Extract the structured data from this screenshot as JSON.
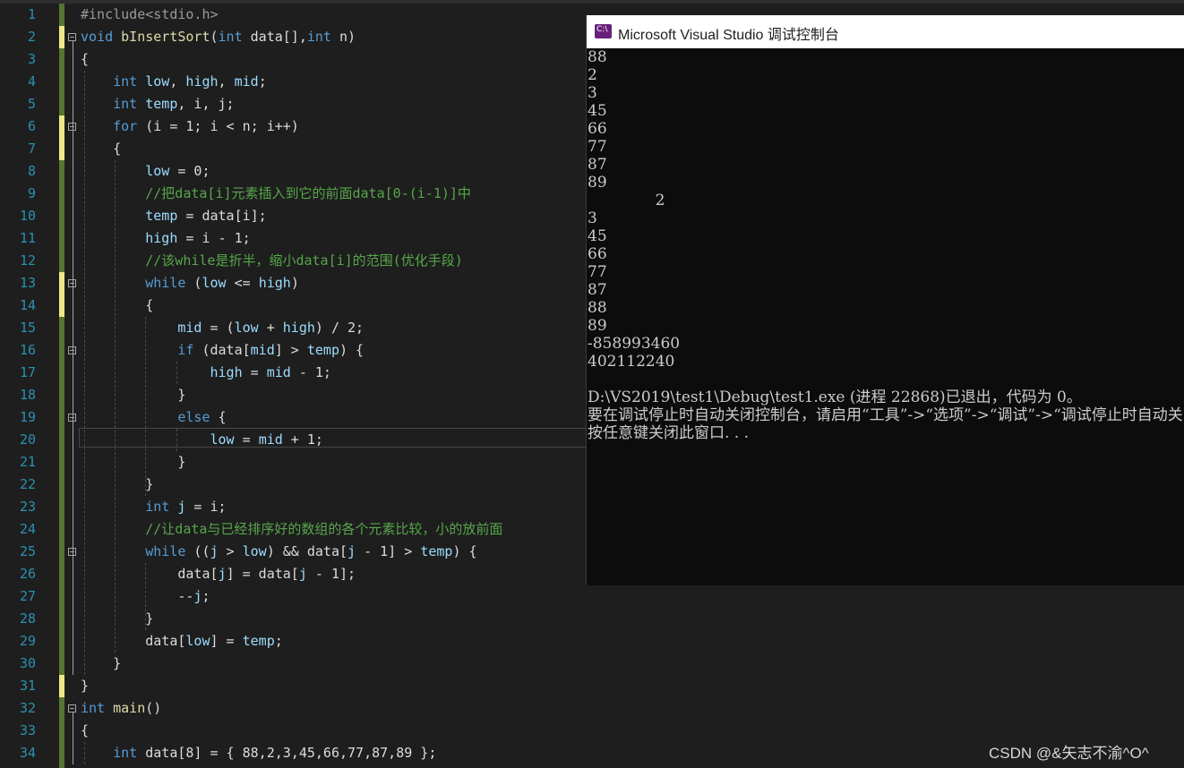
{
  "console": {
    "title": "Microsoft Visual Studio 调试控制台",
    "icon": "vs-icon",
    "output_lines": [
      "88",
      "2",
      "3",
      "45",
      "66",
      "77",
      "87",
      "89",
      "              2",
      "3",
      "45",
      "66",
      "77",
      "87",
      "88",
      "89",
      "-858993460",
      "402112240",
      "",
      "D:\\VS2019\\test1\\Debug\\test1.exe (进程 22868)已退出，代码为 0。",
      "要在调试停止时自动关闭控制台，请启用“工具”->“选项”->“调试”->“调试停止时自动关闭控制台”。",
      "按任意键关闭此窗口. . ."
    ]
  },
  "editor": {
    "line_numbers": [
      "1",
      "2",
      "3",
      "4",
      "5",
      "6",
      "7",
      "8",
      "9",
      "10",
      "11",
      "12",
      "13",
      "14",
      "15",
      "16",
      "17",
      "18",
      "19",
      "20",
      "21",
      "22",
      "23",
      "24",
      "25",
      "26",
      "27",
      "28",
      "29",
      "30",
      "31",
      "32",
      "33",
      "34"
    ],
    "lines": [
      [
        {
          "t": "#include<stdio.h>",
          "c": "pp"
        }
      ],
      [
        {
          "t": "void",
          "c": "kw"
        },
        {
          "t": " "
        },
        {
          "t": "bInsertSort",
          "c": "fn"
        },
        {
          "t": "("
        },
        {
          "t": "int",
          "c": "kw"
        },
        {
          "t": " data[],"
        },
        {
          "t": "int",
          "c": "kw"
        },
        {
          "t": " n)"
        }
      ],
      [
        {
          "t": "{"
        }
      ],
      [
        {
          "t": "    "
        },
        {
          "t": "int",
          "c": "kw"
        },
        {
          "t": " "
        },
        {
          "t": "low",
          "c": "var"
        },
        {
          "t": ", "
        },
        {
          "t": "high",
          "c": "var"
        },
        {
          "t": ", "
        },
        {
          "t": "mid",
          "c": "var"
        },
        {
          "t": ";"
        }
      ],
      [
        {
          "t": "    "
        },
        {
          "t": "int",
          "c": "kw"
        },
        {
          "t": " "
        },
        {
          "t": "temp",
          "c": "var"
        },
        {
          "t": ", i, j;"
        }
      ],
      [
        {
          "t": "    "
        },
        {
          "t": "for",
          "c": "kw"
        },
        {
          "t": " (i = 1; i < n; i++)"
        }
      ],
      [
        {
          "t": "    {"
        }
      ],
      [
        {
          "t": "        "
        },
        {
          "t": "low",
          "c": "var"
        },
        {
          "t": " = 0;"
        }
      ],
      [
        {
          "t": "        "
        },
        {
          "t": "//把data[i]元素插入到它的前面data[0-(i-1)]中",
          "c": "cm"
        }
      ],
      [
        {
          "t": "        "
        },
        {
          "t": "temp",
          "c": "var"
        },
        {
          "t": " = data[i];"
        }
      ],
      [
        {
          "t": "        "
        },
        {
          "t": "high",
          "c": "var"
        },
        {
          "t": " = i - 1;"
        }
      ],
      [
        {
          "t": "        "
        },
        {
          "t": "//该while是折半，缩小data[i]的范围(优化手段)",
          "c": "cm"
        }
      ],
      [
        {
          "t": "        "
        },
        {
          "t": "while",
          "c": "kw"
        },
        {
          "t": " ("
        },
        {
          "t": "low",
          "c": "var"
        },
        {
          "t": " <= "
        },
        {
          "t": "high",
          "c": "var"
        },
        {
          "t": ")"
        }
      ],
      [
        {
          "t": "        {"
        }
      ],
      [
        {
          "t": "            "
        },
        {
          "t": "mid",
          "c": "var"
        },
        {
          "t": " = ("
        },
        {
          "t": "low",
          "c": "var"
        },
        {
          "t": " + "
        },
        {
          "t": "high",
          "c": "var"
        },
        {
          "t": ") / 2;"
        }
      ],
      [
        {
          "t": "            "
        },
        {
          "t": "if",
          "c": "kw"
        },
        {
          "t": " (data["
        },
        {
          "t": "mid",
          "c": "var"
        },
        {
          "t": "] > "
        },
        {
          "t": "temp",
          "c": "var"
        },
        {
          "t": ") {"
        }
      ],
      [
        {
          "t": "                "
        },
        {
          "t": "high",
          "c": "var"
        },
        {
          "t": " = "
        },
        {
          "t": "mid",
          "c": "var"
        },
        {
          "t": " - 1;"
        }
      ],
      [
        {
          "t": "            }"
        }
      ],
      [
        {
          "t": "            "
        },
        {
          "t": "else",
          "c": "kw"
        },
        {
          "t": " {"
        }
      ],
      [
        {
          "t": "                "
        },
        {
          "t": "low",
          "c": "var"
        },
        {
          "t": " = "
        },
        {
          "t": "mid",
          "c": "var"
        },
        {
          "t": " + 1;"
        }
      ],
      [
        {
          "t": "            }"
        }
      ],
      [
        {
          "t": "        }"
        }
      ],
      [
        {
          "t": "        "
        },
        {
          "t": "int",
          "c": "kw"
        },
        {
          "t": " "
        },
        {
          "t": "j",
          "c": "var"
        },
        {
          "t": " = i;"
        }
      ],
      [
        {
          "t": "        "
        },
        {
          "t": "//让data与已经排序好的数组的各个元素比较，小的放前面",
          "c": "cm"
        }
      ],
      [
        {
          "t": "        "
        },
        {
          "t": "while",
          "c": "kw"
        },
        {
          "t": " (("
        },
        {
          "t": "j",
          "c": "var"
        },
        {
          "t": " > "
        },
        {
          "t": "low",
          "c": "var"
        },
        {
          "t": ") && data["
        },
        {
          "t": "j",
          "c": "var"
        },
        {
          "t": " - 1] > "
        },
        {
          "t": "temp",
          "c": "var"
        },
        {
          "t": ") {"
        }
      ],
      [
        {
          "t": "            data["
        },
        {
          "t": "j",
          "c": "var"
        },
        {
          "t": "] = data["
        },
        {
          "t": "j",
          "c": "var"
        },
        {
          "t": " - 1];"
        }
      ],
      [
        {
          "t": "            --"
        },
        {
          "t": "j",
          "c": "var"
        },
        {
          "t": ";"
        }
      ],
      [
        {
          "t": "        }"
        }
      ],
      [
        {
          "t": "        data["
        },
        {
          "t": "low",
          "c": "var"
        },
        {
          "t": "] = "
        },
        {
          "t": "temp",
          "c": "var"
        },
        {
          "t": ";"
        }
      ],
      [
        {
          "t": "    }"
        }
      ],
      [
        {
          "t": "}"
        }
      ],
      [
        {
          "t": "int",
          "c": "kw"
        },
        {
          "t": " "
        },
        {
          "t": "main",
          "c": "fn"
        },
        {
          "t": "()"
        }
      ],
      [
        {
          "t": "{"
        }
      ],
      [
        {
          "t": "    "
        },
        {
          "t": "int",
          "c": "kw"
        },
        {
          "t": " data[8] = { 88,2,3,45,66,77,87,89 };"
        }
      ]
    ]
  },
  "watermark": "CSDN @&矢志不渝^O^",
  "colors": {
    "keyword": "#569cd6",
    "function": "#dcdcaa",
    "comment": "#57a64a",
    "variable": "#9cdcfe",
    "line_number": "#2b91af",
    "change_saved": "#577430",
    "change_unsaved": "#efe886"
  }
}
